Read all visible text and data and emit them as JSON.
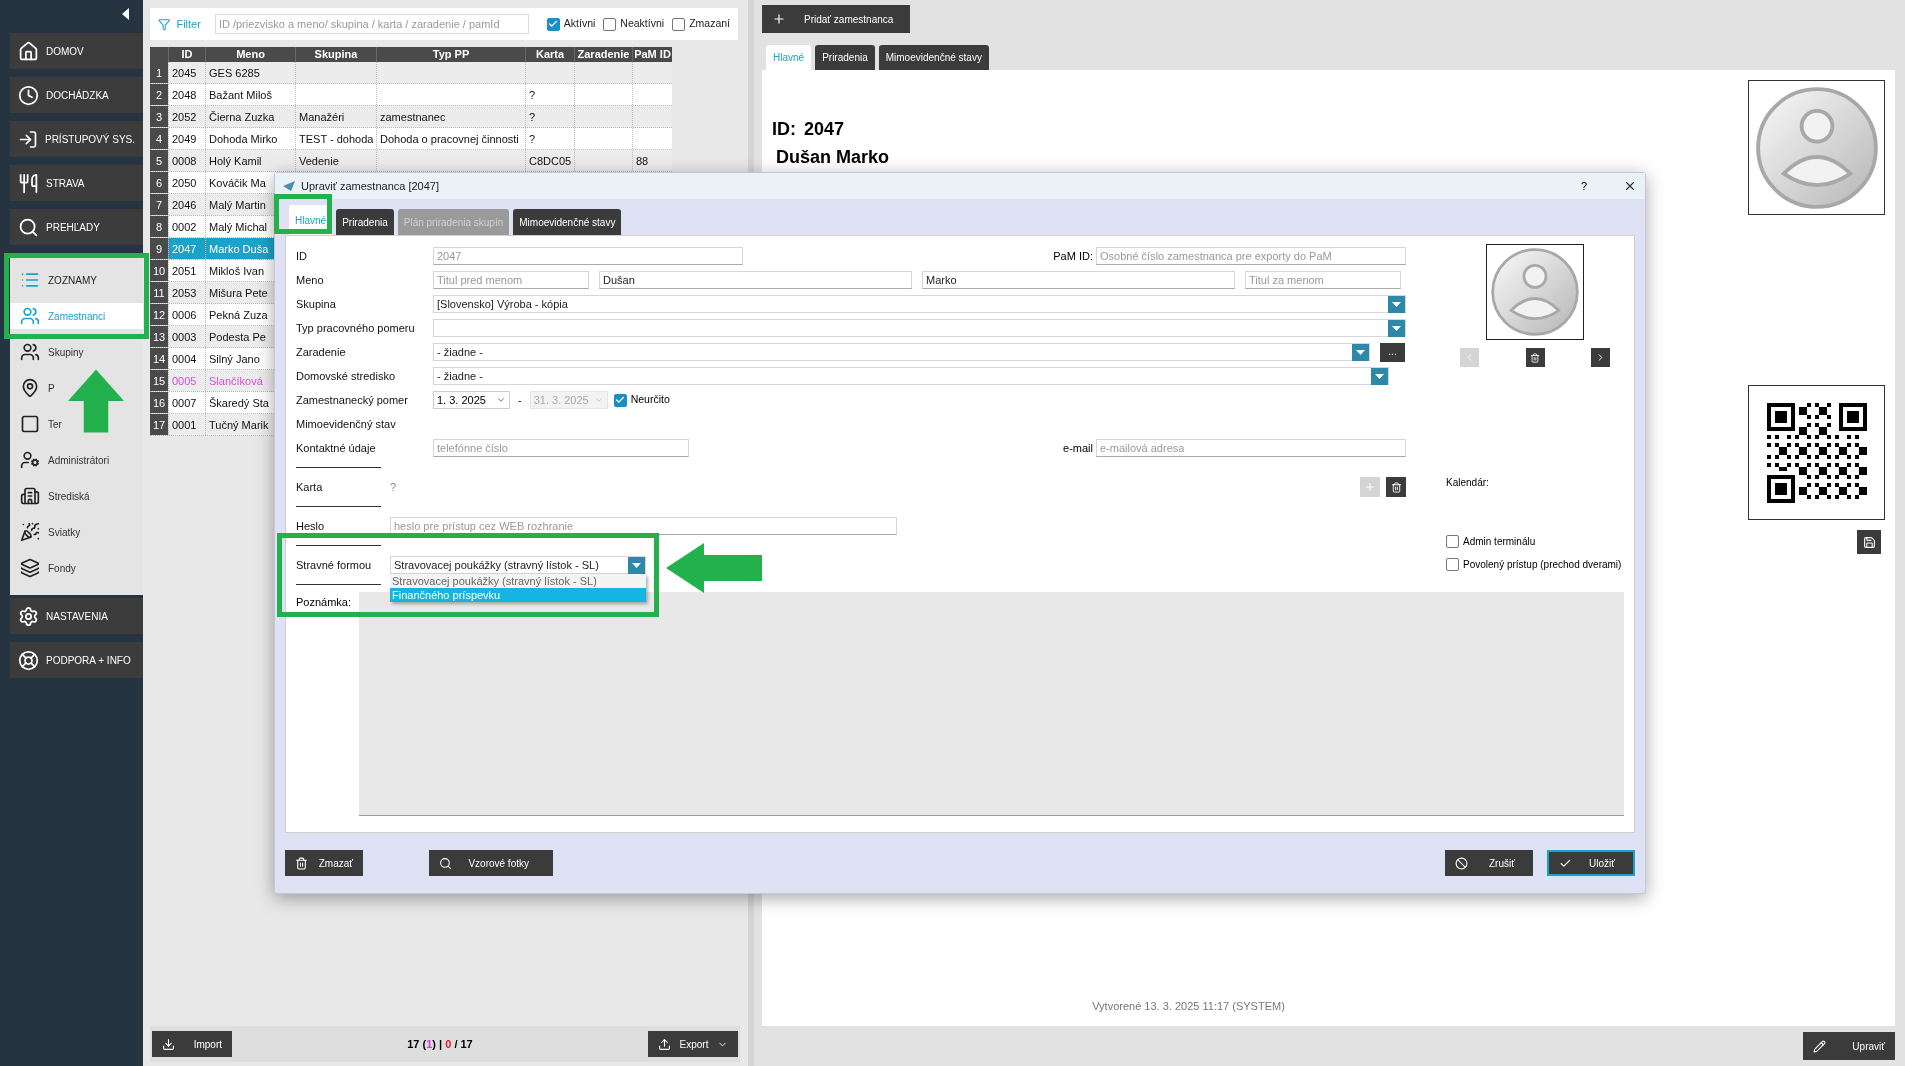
{
  "sidebar": {
    "items": [
      {
        "label": "DOMOV",
        "kind": "main",
        "selected": false
      },
      {
        "label": "DOCHÁDZKA",
        "kind": "main",
        "selected": false
      },
      {
        "label": "PRÍSTUPOVÝ SYS.",
        "kind": "main",
        "selected": false
      },
      {
        "label": "STRAVA",
        "kind": "main",
        "selected": false
      },
      {
        "label": "PREHĽADY",
        "kind": "main",
        "selected": false
      },
      {
        "label": "ZOZNAMY",
        "kind": "section",
        "selected": false
      },
      {
        "label": "Zamestnanci",
        "kind": "sub",
        "selected": true
      },
      {
        "label": "Skupiny",
        "kind": "sub",
        "selected": false
      },
      {
        "label": "P",
        "kind": "sub",
        "selected": false
      },
      {
        "label": "Ter",
        "kind": "sub",
        "selected": false
      },
      {
        "label": "Administrátori",
        "kind": "sub",
        "selected": false
      },
      {
        "label": "Strediská",
        "kind": "sub",
        "selected": false
      },
      {
        "label": "Sviatky",
        "kind": "sub",
        "selected": false
      },
      {
        "label": "Fondy",
        "kind": "sub",
        "selected": false
      },
      {
        "label": "NASTAVENIA",
        "kind": "main",
        "selected": false
      },
      {
        "label": "PODPORA + INFO",
        "kind": "main",
        "selected": false
      }
    ]
  },
  "filter": {
    "label": "Filter",
    "placeholder": "ID /priezvisko a meno/ skupina / karta / zaradenie / pamId",
    "checks": [
      {
        "label": "Aktívni",
        "checked": true
      },
      {
        "label": "Neaktívni",
        "checked": false
      },
      {
        "label": "Zmazaní",
        "checked": false
      }
    ]
  },
  "table": {
    "columns": [
      "ID",
      "Meno",
      "Skupina",
      "Typ PP",
      "Karta",
      "Zaradenie",
      "PaM ID"
    ],
    "rows": [
      {
        "num": "1",
        "kind": "normal",
        "selected": false,
        "cells": [
          "2045",
          "GES 6285",
          null,
          null,
          null,
          null,
          null
        ]
      },
      {
        "num": "2",
        "kind": "normal",
        "selected": false,
        "cells": [
          "2048",
          "Bažant Miloš",
          null,
          null,
          "?",
          null,
          null
        ]
      },
      {
        "num": "3",
        "kind": "normal",
        "selected": false,
        "cells": [
          "2052",
          "Čierna Zuzka",
          "Manažéri",
          "zamestnanec",
          "?",
          null,
          null
        ]
      },
      {
        "num": "4",
        "kind": "normal",
        "selected": false,
        "cells": [
          "2049",
          "Dohoda Mirko",
          "TEST - dohoda",
          "Dohoda o pracovnej činnosti",
          "?",
          null,
          null
        ]
      },
      {
        "num": "5",
        "kind": "normal",
        "selected": false,
        "cells": [
          "0008",
          "Holý Kamil",
          "Vedenie",
          null,
          "C8DC05",
          null,
          "88"
        ]
      },
      {
        "num": "6",
        "kind": "normal",
        "selected": false,
        "cells": [
          "2050",
          "Kováčik Ma"
        ]
      },
      {
        "num": "7",
        "kind": "normal",
        "selected": false,
        "cells": [
          "2046",
          "Malý Martin"
        ]
      },
      {
        "num": "8",
        "kind": "normal",
        "selected": false,
        "cells": [
          "0002",
          "Malý Michal"
        ]
      },
      {
        "num": "9",
        "kind": "normal",
        "selected": true,
        "cells": [
          "2047",
          "Marko Duša"
        ]
      },
      {
        "num": "10",
        "kind": "normal",
        "selected": false,
        "cells": [
          "2051",
          "Mikloš Ivan"
        ]
      },
      {
        "num": "11",
        "kind": "normal",
        "selected": false,
        "cells": [
          "2053",
          "Mišura Pete"
        ]
      },
      {
        "num": "12",
        "kind": "normal",
        "selected": false,
        "cells": [
          "0006",
          "Pekná Zuza"
        ]
      },
      {
        "num": "13",
        "kind": "normal",
        "selected": false,
        "cells": [
          "0003",
          "Podesta Pe"
        ]
      },
      {
        "num": "14",
        "kind": "normal",
        "selected": false,
        "cells": [
          "0004",
          "Silný Jano"
        ]
      },
      {
        "num": "15",
        "kind": "marked",
        "selected": false,
        "cells": [
          "0005",
          "Slančíková"
        ]
      },
      {
        "num": "16",
        "kind": "normal",
        "selected": false,
        "cells": [
          "0007",
          "Škaredý Sta"
        ]
      },
      {
        "num": "17",
        "kind": "normal",
        "selected": false,
        "cells": [
          "0001",
          "Tučný Marik"
        ]
      }
    ]
  },
  "list_footer": {
    "import": "Import",
    "export": "Export",
    "counter": [
      {
        "text": "17 (",
        "kind": "plain"
      },
      {
        "text": "1",
        "kind": "selected"
      },
      {
        "text": ") | ",
        "kind": "plain"
      },
      {
        "text": "0",
        "kind": "deleted"
      },
      {
        "text": " / 17",
        "kind": "plain"
      }
    ]
  },
  "detail": {
    "add_button": "Pridať zamestnanca",
    "tabs": [
      {
        "label": "Hlavné",
        "selected": true
      },
      {
        "label": "Priradenia",
        "selected": false
      },
      {
        "label": "Mimoevidenčné stavy",
        "selected": false
      }
    ],
    "id_label": "ID:",
    "id": "2047",
    "name": "Dušan Marko",
    "created": "Vytvorené 13. 3. 2025 11:17 (SYSTEM)",
    "edit_button": "Upraviť"
  },
  "dialog": {
    "title": "Upraviť zamestnanca [2047]",
    "help": "?",
    "tabs": [
      {
        "label": "Hlavné",
        "selected": true,
        "disabled": false
      },
      {
        "label": "Priradenia",
        "selected": false,
        "disabled": false
      },
      {
        "label": "Plán priradenia skupín",
        "selected": false,
        "disabled": true
      },
      {
        "label": "Mimoevidenčné stavy",
        "selected": false,
        "disabled": false
      }
    ],
    "id": {
      "label": "ID",
      "value": "2047",
      "disabled": true
    },
    "pam_id": {
      "label": "PaM ID:",
      "placeholder": "Osobné číslo zamestnanca pre exporty do PaM"
    },
    "meno": {
      "label": "Meno",
      "title_before_placeholder": "Titul pred menom",
      "first": "Dušan",
      "last": "Marko",
      "title_after_placeholder": "Titul za menom"
    },
    "skupina": {
      "label": "Skupina",
      "value": "[Slovensko] Výroba - kópia"
    },
    "typ": {
      "label": "Typ pracovného pomeru"
    },
    "zaradenie": {
      "label": "Zaradenie",
      "value": "- žiadne -",
      "more": "..."
    },
    "stredisko": {
      "label": "Domovské stredisko",
      "value": "- žiadne -"
    },
    "pomer": {
      "label": "Zamestnanecký pomer",
      "from": "1. 3. 2025",
      "separator": "-",
      "to": "31. 3. 2025",
      "to_disabled": true,
      "indefinite": {
        "label": "Neurčito",
        "checked": true
      }
    },
    "mimo": {
      "label": "Mimoevidenčný stav"
    },
    "kontakt": {
      "label": "Kontaktné údaje",
      "phone_placeholder": "telefónne číslo",
      "email_label": "e-mail",
      "email_placeholder": "e-mailová adresa"
    },
    "karta": {
      "label": "Karta",
      "value": "?"
    },
    "heslo": {
      "label": "Heslo",
      "placeholder": "heslo pre prístup cez WEB rozhranie"
    },
    "stravne": {
      "label": "Stravné formou",
      "value": "Stravovacej poukážky (stravný lístok - SL)",
      "expanded": true,
      "options": [
        {
          "label": "Stravovacej poukážky (stravný lístok - SL)",
          "highlighted": false
        },
        {
          "label": "Finančného príspevku",
          "highlighted": true
        }
      ]
    },
    "poznamka": {
      "label": "Poznámka:"
    },
    "kalendar": "Kalendár:",
    "checks": [
      {
        "label": "Admin terminálu",
        "checked": false
      },
      {
        "label": "Povolený prístup (prechod dverami)",
        "checked": false
      }
    ],
    "buttons": {
      "delete": "Zmazať",
      "photos": "Vzorové fotky",
      "cancel": "Zrušiť",
      "save": "Uložiť"
    }
  }
}
